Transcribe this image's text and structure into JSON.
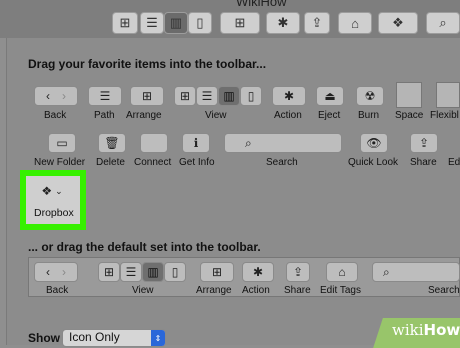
{
  "window": {
    "title": "WikiHow"
  },
  "sheet": {
    "title": "Drag your favorite items into the toolbar...",
    "default_set_title": "... or drag the default set into the toolbar.",
    "show_label": "Show",
    "show_value": "Icon Only"
  },
  "palette_row1": {
    "back": "Back",
    "path": "Path",
    "arrange": "Arrange",
    "view": "View",
    "action": "Action",
    "eject": "Eject",
    "burn": "Burn",
    "space": "Space",
    "flexible": "Flexibl"
  },
  "palette_row2": {
    "new_folder": "New Folder",
    "delete": "Delete",
    "connect": "Connect",
    "get_info": "Get Info",
    "search": "Search",
    "quick_look": "Quick Look",
    "share": "Share",
    "edit": "Edi"
  },
  "dropbox": {
    "label": "Dropbox"
  },
  "default_bar": {
    "back": "Back",
    "view": "View",
    "arrange": "Arrange",
    "action": "Action",
    "share": "Share",
    "edit_tags": "Edit Tags",
    "search": "Search"
  },
  "icons": {
    "back": "‹",
    "forward": "›",
    "list": "☰",
    "columns": "▥",
    "coverflow": "▯",
    "grid": "⊞",
    "gear": "✱",
    "eject": "⏏",
    "burn": "☢",
    "folder": "▭",
    "trash": "🗑",
    "info": "ℹ",
    "search": "⌕",
    "eye": "👁",
    "share": "⇪",
    "tag": "⌂",
    "dropbox": "❖"
  },
  "watermark": {
    "wiki": "wiki",
    "how": "How"
  }
}
